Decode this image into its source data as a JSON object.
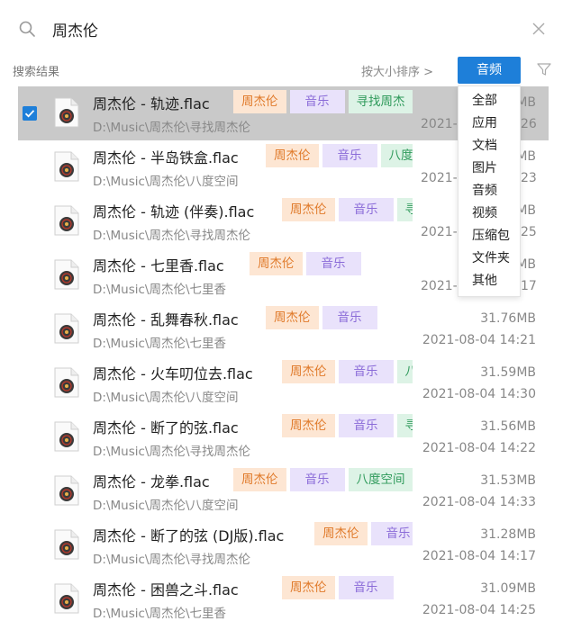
{
  "search": {
    "value": "周杰伦"
  },
  "toolbar": {
    "results_label": "搜索结果",
    "sort_label": "按大小排序 >",
    "type_label": "音频"
  },
  "dropdown": {
    "items": [
      "全部",
      "应用",
      "文档",
      "图片",
      "音频",
      "视频",
      "压缩包",
      "文件夹",
      "其他"
    ]
  },
  "colors": {
    "accent": "#1e7fd9",
    "selected_row": "#c9c9c9",
    "tag_artist_bg": "#fde6d3",
    "tag_kind_bg": "#e9e2fb",
    "tag_album_bg": "#ddf3e6"
  },
  "icons": {
    "search": "search-icon",
    "close": "close-icon",
    "filter": "filter-icon",
    "file": "music-file-icon",
    "checkbox": "checkbox-checked-icon"
  },
  "results": [
    {
      "name": "周杰伦 - 轨迹.flac",
      "path": "D:\\Music\\周杰伦\\寻找周杰伦",
      "size": "MB",
      "date": "2021-",
      "date_tail": "26",
      "tags": [
        "周杰伦",
        "音乐",
        "寻找周杰"
      ],
      "selected": true
    },
    {
      "name": "周杰伦 - 半岛铁盒.flac",
      "path": "D:\\Music\\周杰伦\\八度空间",
      "size": "MB",
      "date": "2021-",
      "date_tail": "23",
      "tags": [
        "周杰伦",
        "音乐",
        "八度"
      ],
      "selected": false
    },
    {
      "name": "周杰伦 - 轨迹 (伴奏).flac",
      "path": "D:\\Music\\周杰伦\\寻找周杰伦",
      "size": "MB",
      "date": "2021-",
      "date_tail": "25",
      "tags": [
        "周杰伦",
        "音乐",
        "寻"
      ],
      "selected": false
    },
    {
      "name": "周杰伦 - 七里香.flac",
      "path": "D:\\Music\\周杰伦\\七里香",
      "size": "MB",
      "date": "2021-",
      "date_tail": "17",
      "tags": [
        "周杰伦",
        "音乐"
      ],
      "selected": false
    },
    {
      "name": "周杰伦 - 乱舞春秋.flac",
      "path": "D:\\Music\\周杰伦\\七里香",
      "size": "31.76MB",
      "date": "2021-08-04 14:21",
      "date_tail": "",
      "tags": [
        "周杰伦",
        "音乐"
      ],
      "selected": false
    },
    {
      "name": "周杰伦 - 火车叨位去.flac",
      "path": "D:\\Music\\周杰伦\\八度空间",
      "size": "31.59MB",
      "date": "2021-08-04 14:30",
      "date_tail": "",
      "tags": [
        "周杰伦",
        "音乐",
        "八"
      ],
      "selected": false
    },
    {
      "name": "周杰伦 - 断了的弦.flac",
      "path": "D:\\Music\\周杰伦\\寻找周杰伦",
      "size": "31.56MB",
      "date": "2021-08-04 14:22",
      "date_tail": "",
      "tags": [
        "周杰伦",
        "音乐",
        "寻找"
      ],
      "selected": false
    },
    {
      "name": "周杰伦 - 龙拳.flac",
      "path": "D:\\Music\\周杰伦\\八度空间",
      "size": "31.53MB",
      "date": "2021-08-04 14:33",
      "date_tail": "",
      "tags": [
        "周杰伦",
        "音乐",
        "八度空间"
      ],
      "selected": false
    },
    {
      "name": "周杰伦 - 断了的弦 (DJ版).flac",
      "path": "D:\\Music\\周杰伦\\寻找周杰伦",
      "size": "31.28MB",
      "date": "2021-08-04 14:17",
      "date_tail": "",
      "tags": [
        "周杰伦",
        "音乐"
      ],
      "selected": false
    },
    {
      "name": "周杰伦 - 困兽之斗.flac",
      "path": "D:\\Music\\周杰伦\\七里香",
      "size": "31.09MB",
      "date": "2021-08-04 14:25",
      "date_tail": "",
      "tags": [
        "周杰伦",
        "音乐"
      ],
      "selected": false
    }
  ]
}
